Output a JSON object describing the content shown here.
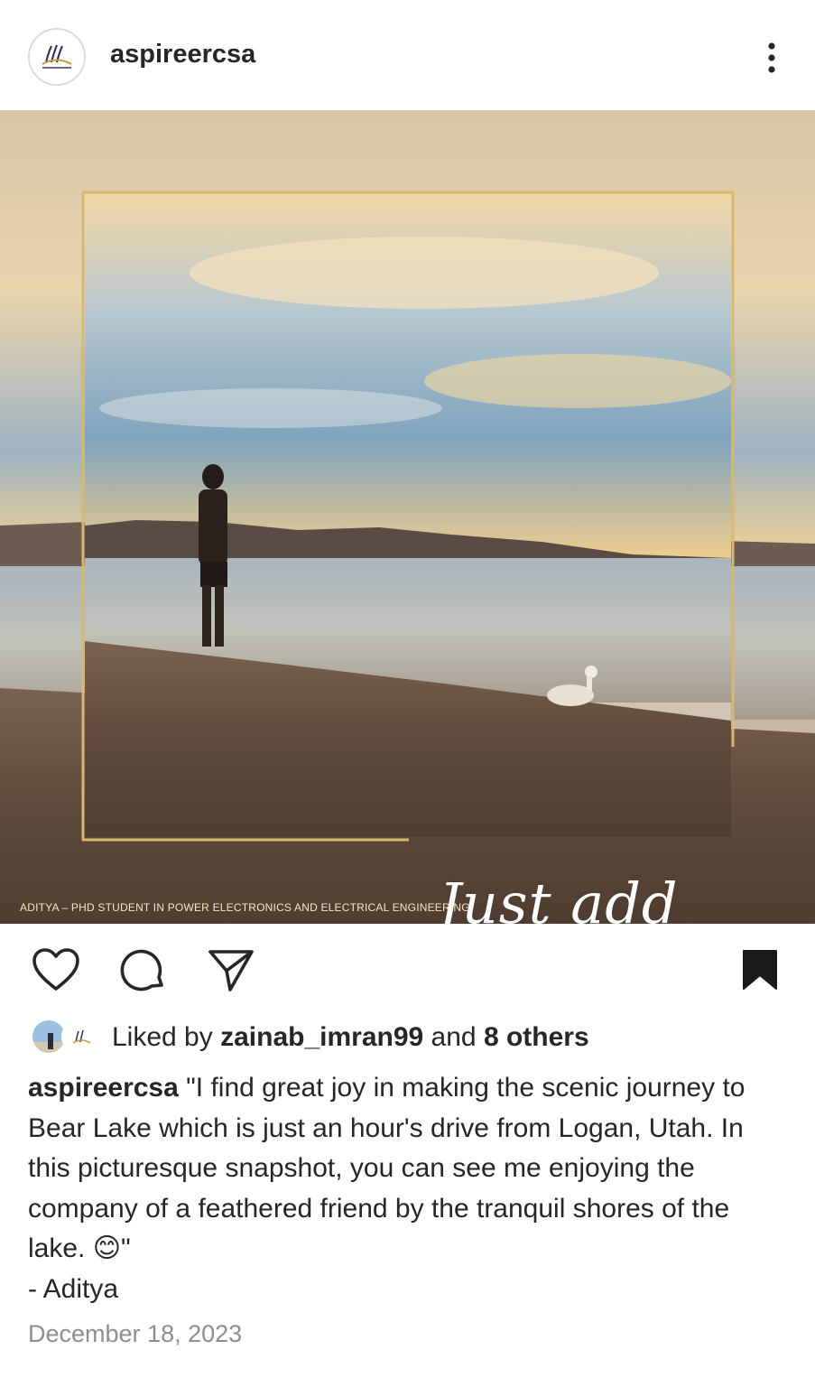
{
  "post": {
    "username": "aspireercsa",
    "photo": {
      "overlay_text": "Just add water",
      "credit": "ADITYA – PHD STUDENT IN POWER ELECTRONICS AND ELECTRICAL ENGINEERING"
    },
    "icons": {
      "more": "more-vertical-icon",
      "like": "heart-icon",
      "comment": "comment-icon",
      "share": "send-icon",
      "save": "bookmark-icon"
    },
    "likes": {
      "prefix": "Liked by",
      "user": "zainab_imran99",
      "conjunction": "and",
      "others": "8 others"
    },
    "caption": {
      "user": "aspireercsa",
      "text": "\"I find great joy in making the scenic journey to Bear Lake which is just an hour's drive from Logan, Utah. In this picturesque snapshot, you can see me enjoying the company of a feathered friend by the tranquil shores of the lake. 😊\"",
      "signature": "- Aditya"
    },
    "date": "December 18, 2023"
  },
  "colors": {
    "text": "#262626",
    "muted": "#8e8e8e",
    "frame_gold": "#d8b770"
  }
}
